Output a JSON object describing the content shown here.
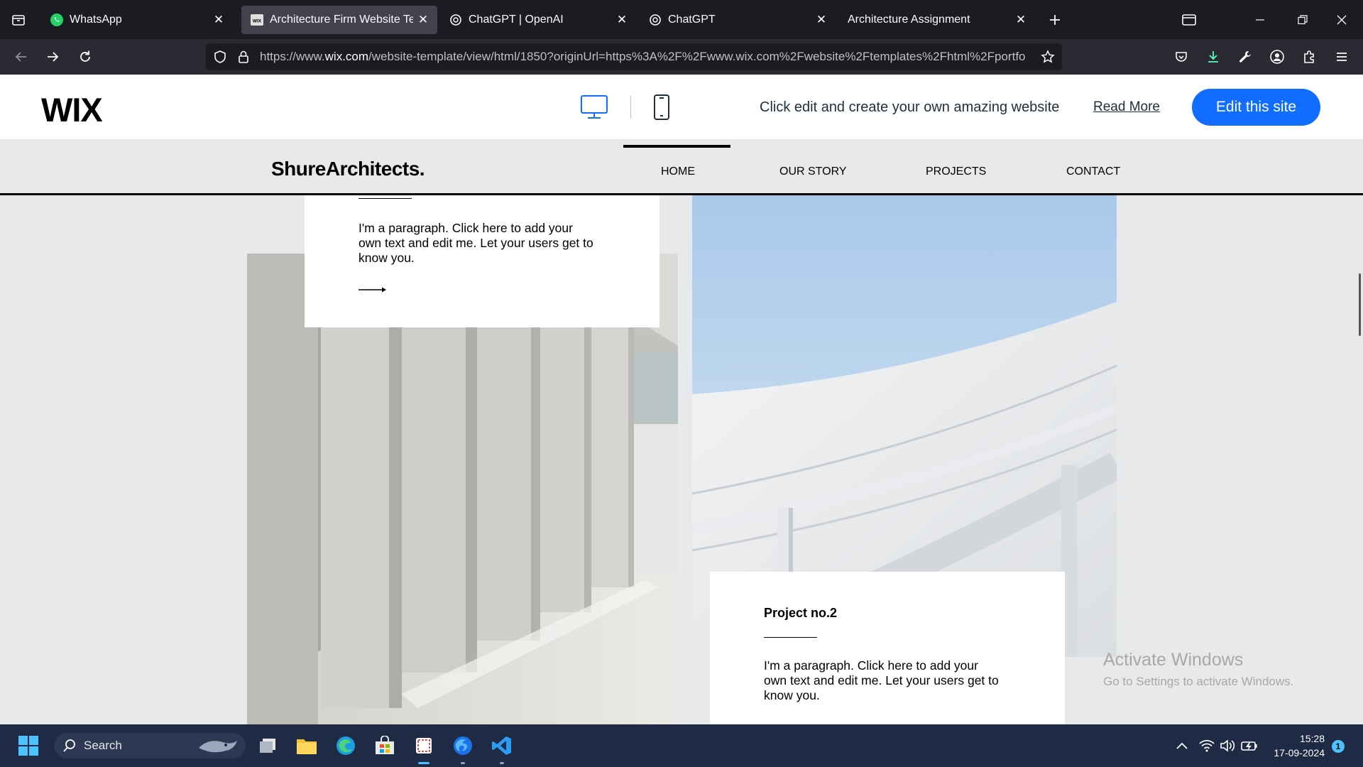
{
  "browser": {
    "tabs": [
      {
        "label": "WhatsApp",
        "icon": "whatsapp-icon",
        "active": false
      },
      {
        "label": "Architecture Firm Website Temp",
        "icon": "wix-favicon",
        "active": true
      },
      {
        "label": "ChatGPT | OpenAI",
        "icon": "openai-icon",
        "active": false
      },
      {
        "label": "ChatGPT",
        "icon": "openai-icon",
        "active": false
      },
      {
        "label": "Architecture Assignment",
        "icon": "",
        "active": false
      }
    ],
    "url_prefix": "https://www.",
    "url_domain": "wix.com",
    "url_rest": "/website-template/view/html/1850?originUrl=https%3A%2F%2Fwww.wix.com%2Fwebsite%2Ftemplates%2Fhtml%2Fportfo"
  },
  "wix": {
    "logo": "WIX",
    "tagline": "Click edit and create your own amazing website",
    "read_more": "Read More",
    "edit_button": "Edit this site"
  },
  "site": {
    "logo": "ShureArchitects.",
    "menu": [
      {
        "label": "HOME",
        "active": true
      },
      {
        "label": "OUR STORY",
        "active": false
      },
      {
        "label": "PROJECTS",
        "active": false
      },
      {
        "label": "CONTACT",
        "active": false
      }
    ]
  },
  "cards": [
    {
      "title": "",
      "paragraph": [
        "I'm a paragraph. Click here to add your",
        "own text and edit me. Let your users get to",
        "know you."
      ]
    },
    {
      "title": "Project no.2",
      "paragraph": [
        "I'm a paragraph. Click here to add your",
        "own text and edit me. Let your users get to",
        "know you."
      ]
    }
  ],
  "watermark": {
    "line1": "Activate Windows",
    "line2": "Go to Settings to activate Windows."
  },
  "taskbar": {
    "search": "Search",
    "time": "15:28",
    "date": "17-09-2024",
    "notifications": "1"
  },
  "colors": {
    "wix_blue": "#116dff",
    "browser_dark": "#1c1b22",
    "taskbar": "#1f2a44"
  }
}
